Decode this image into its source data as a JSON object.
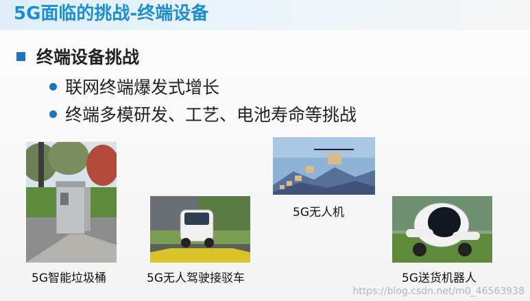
{
  "slide": {
    "title": "5G面临的挑战-终端设备",
    "heading": "终端设备挑战",
    "bullets": [
      "联网终端爆发式增长",
      "终端多模研发、工艺、电池寿命等挑战"
    ]
  },
  "images": [
    {
      "caption": "5G智能垃圾桶",
      "icon": "smart-trash-bin"
    },
    {
      "caption": "5G无人驾驶接驳车",
      "icon": "driverless-shuttle"
    },
    {
      "caption": "5G无人机",
      "icon": "delivery-drones"
    },
    {
      "caption": "5G送货机器人",
      "icon": "delivery-robot"
    }
  ],
  "watermark": "https://blog.csdn.net/m0_46563938",
  "colors": {
    "title": "#1a8fd5",
    "accent": "#1a74c4"
  }
}
